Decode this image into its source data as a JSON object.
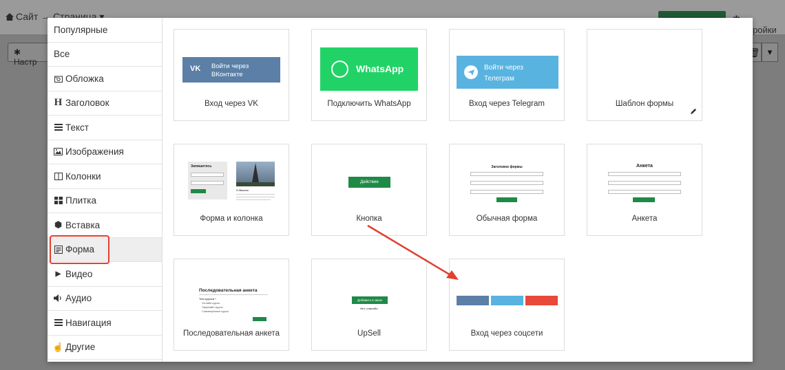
{
  "background": {
    "breadcrumb": "Сайт → Страница",
    "settings_label": "Настройки",
    "left_button_label": "Настр"
  },
  "sidebar": {
    "items": [
      {
        "label": "Популярные",
        "icon": ""
      },
      {
        "label": "Все",
        "icon": ""
      },
      {
        "label": "Обложка",
        "icon": "camera-icon"
      },
      {
        "label": "Заголовок",
        "icon": "heading-icon"
      },
      {
        "label": "Текст",
        "icon": "text-lines-icon"
      },
      {
        "label": "Изображения",
        "icon": "image-icon"
      },
      {
        "label": "Колонки",
        "icon": "columns-icon"
      },
      {
        "label": "Плитка",
        "icon": "tiles-icon"
      },
      {
        "label": "Вставка",
        "icon": "cubes-icon"
      },
      {
        "label": "Форма",
        "icon": "form-icon"
      },
      {
        "label": "Видео",
        "icon": "youtube-icon"
      },
      {
        "label": "Аудио",
        "icon": "volume-icon"
      },
      {
        "label": "Навигация",
        "icon": "bars-icon"
      },
      {
        "label": "Другие",
        "icon": "hand-icon"
      }
    ],
    "active_index": 9
  },
  "cards": [
    {
      "label": "Вход через VK",
      "preview": {
        "logo": "VK",
        "text1": "Войти через",
        "text2": "ВКонтакте"
      }
    },
    {
      "label": "Подключить WhatsApp",
      "preview": {
        "text": "WhatsApp"
      }
    },
    {
      "label": "Вход через Telegram",
      "preview": {
        "text1": "Войти через",
        "text2": "Телеграм"
      }
    },
    {
      "label": "Шаблон формы"
    },
    {
      "label": "Форма и колонка",
      "preview": {
        "title": "Запишитесь",
        "text": "О Вашем"
      }
    },
    {
      "label": "Кнопка",
      "preview": {
        "button": "Действие"
      }
    },
    {
      "label": "Обычная форма",
      "preview": {
        "title": "Заголовок формы"
      }
    },
    {
      "label": "Анкета",
      "preview": {
        "title": "Анкета"
      }
    },
    {
      "label": "Последовательная анкета",
      "preview": {
        "title": "Последовательная анкета",
        "question": "Тип курсов *",
        "options": [
          "Онлайн курсы",
          "Оффлайн курсы",
          "Совмещённые курсы"
        ]
      }
    },
    {
      "label": "UpSell",
      "preview": {
        "button": "Добавить в заказ",
        "link": "Нет, спасибо"
      }
    },
    {
      "label": "Вход через соцсети"
    }
  ],
  "colors": {
    "highlight": "#e0402f",
    "vk": "#5b7fa6",
    "whatsapp": "#21d366",
    "telegram": "#59b3e0",
    "action_green": "#1f8a48",
    "google": "#e8493a"
  }
}
